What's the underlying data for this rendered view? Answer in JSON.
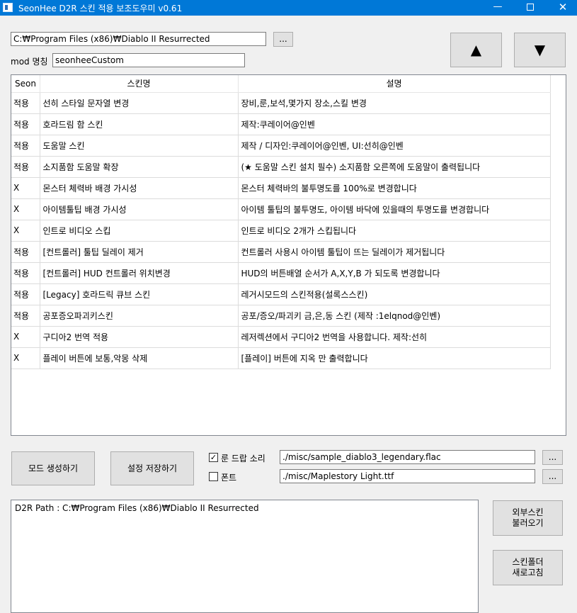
{
  "window": {
    "title": "SeonHee D2R 스킨 적용 보조도우미 v0.61",
    "minimize_glyph": "—",
    "close_glyph": "✕"
  },
  "top": {
    "path_value": "C:₩Program Files (x86)₩Diablo II Resurrected",
    "browse_label": "...",
    "mod_label": "mod 명칭",
    "mod_value": "seonheeCustom",
    "up_arrow": "▲",
    "down_arrow": "▼"
  },
  "grid": {
    "headers": [
      "Seon",
      "스킨명",
      "설명"
    ],
    "rows": [
      {
        "status": "적용",
        "name": "선히 스타일 문자열 변경",
        "desc": "장비,룬,보석,몇가지 장소,스킬 변경"
      },
      {
        "status": "적용",
        "name": "호라드림 함 스킨",
        "desc": "제작:쿠레이어@인벤"
      },
      {
        "status": "적용",
        "name": "도움말 스킨",
        "desc": "제작 / 디자인:쿠레이어@인벤, UI:선히@인벤"
      },
      {
        "status": "적용",
        "name": "소지품함 도움말 확장",
        "desc": "(★ 도움말 스킨 설치 필수) 소지품함 오른쪽에 도움말이 출력됩니다"
      },
      {
        "status": "X",
        "name": "몬스터 체력바 배경 가시성",
        "desc": "몬스터 체력바의 불투명도를 100%로 변경합니다"
      },
      {
        "status": "X",
        "name": "아이템툴팁 배경 가시성",
        "desc": "아이템 툴팁의 불투명도, 아이템 바닥에 있을때의 투명도를 변경합니다"
      },
      {
        "status": "X",
        "name": "인트로 비디오 스킵",
        "desc": "인트로 비디오 2개가 스킵됩니다"
      },
      {
        "status": "적용",
        "name": "[컨트롤러] 툴팁 딜레이 제거",
        "desc": "컨트롤러 사용시 아이템 툴팁이 뜨는 딜레이가 제거됩니다"
      },
      {
        "status": "적용",
        "name": "[컨트롤러] HUD 컨트롤러 위치변경",
        "desc": "HUD의 버튼배열 순서가 A,X,Y,B 가 되도록 변경합니다"
      },
      {
        "status": "적용",
        "name": "[Legacy] 호라드릭 큐브 스킨",
        "desc": "레거시모드의 스킨적용(설록스스킨)"
      },
      {
        "status": "적용",
        "name": "공포증오파괴키스킨",
        "desc": "공포/증오/파괴키 금,은,동 스킨 (제작 :1elqnod@인벤)"
      },
      {
        "status": "X",
        "name": "구디아2 번역 적용",
        "desc": "레저렉션에서 구디아2 번역을 사용합니다. 제작:선히"
      },
      {
        "status": "X",
        "name": "플레이 버튼에 보통,악몽 삭제",
        "desc": "[플레이] 버튼에 지옥 만 출력합니다"
      }
    ]
  },
  "controls": {
    "make_mod_label": "모드 생성하기",
    "save_settings_label": "설정 저장하기",
    "rune_sound_label": "룬 드랍 소리",
    "rune_sound_checked": true,
    "rune_sound_path": "./misc/sample_diablo3_legendary.flac",
    "font_label": "폰트",
    "font_checked": false,
    "font_path": "./misc/Maplestory Light.ttf",
    "browse_label": "..."
  },
  "log": {
    "text": "D2R Path : C:₩Program Files (x86)₩Diablo II Resurrected"
  },
  "side_buttons": {
    "external_skin_line1": "외부스킨",
    "external_skin_line2": "불러오기",
    "refresh_line1": "스킨폴더",
    "refresh_line2": "새로고침"
  }
}
